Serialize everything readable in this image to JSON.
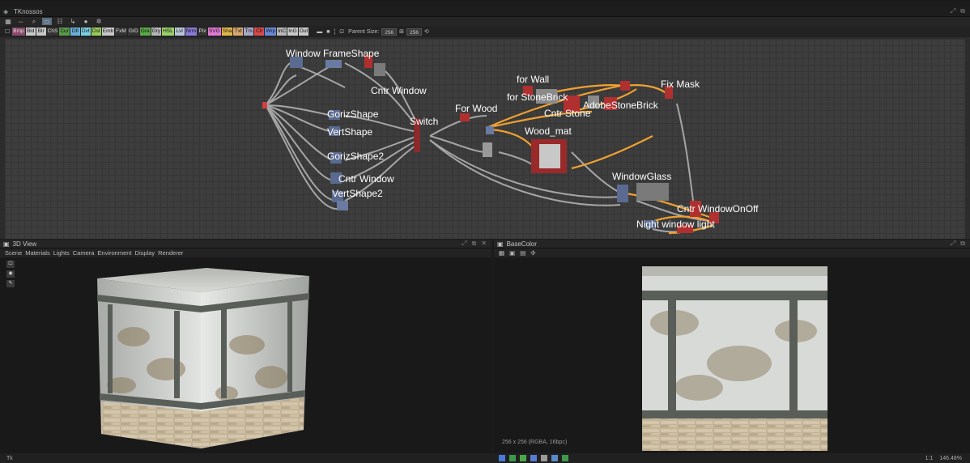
{
  "app": {
    "title": "TKnossos"
  },
  "graph_toolbar": {
    "items": [
      "grid-icon",
      "layout-icon",
      "zoom-icon",
      "select-icon",
      "align-icon",
      "connector-icon",
      "comment-icon",
      "settings-icon"
    ]
  },
  "filter_bar": {
    "chips": [
      {
        "label": "Bmp",
        "color": "#8a4a6a"
      },
      {
        "label": "Bld",
        "color": "#c8c8c8"
      },
      {
        "label": "Blr",
        "color": "#c8c8c8"
      },
      {
        "label": "ChS",
        "color": "#333333"
      },
      {
        "label": "Cur",
        "color": "#5a9a4a"
      },
      {
        "label": "Dfl",
        "color": "#6ab0d8"
      },
      {
        "label": "Dvt",
        "color": "#7ad0e0"
      },
      {
        "label": "Dst",
        "color": "#9acb5a"
      },
      {
        "label": "Emb",
        "color": "#c8c8c8"
      },
      {
        "label": "FxM",
        "color": "#333333"
      },
      {
        "label": "GrD",
        "color": "#333333"
      },
      {
        "label": "Gra",
        "color": "#5aa84a"
      },
      {
        "label": "Gry",
        "color": "#b8b8b8"
      },
      {
        "label": "HSL",
        "color": "#9ad06a"
      },
      {
        "label": "Lvl",
        "color": "#b8c8d8"
      },
      {
        "label": "Nrm",
        "color": "#8a7ad8"
      },
      {
        "label": "Pix",
        "color": "#333333"
      },
      {
        "label": "SVG",
        "color": "#e07ad0"
      },
      {
        "label": "Sha",
        "color": "#e0b84a"
      },
      {
        "label": "Txt",
        "color": "#d8a870"
      },
      {
        "label": "Trs",
        "color": "#a8a8c8"
      },
      {
        "label": "Clr",
        "color": "#d84a4a"
      },
      {
        "label": "Wrp",
        "color": "#6a8ad8"
      },
      {
        "label": "InC",
        "color": "#b8b8b8"
      },
      {
        "label": "InG",
        "color": "#c8c8c8"
      },
      {
        "label": "Out",
        "color": "#c8c8c8"
      }
    ],
    "parent_size_label": "Parent Size:",
    "size_x": "256",
    "size_y": "256"
  },
  "graph_nodes": [
    "Window FrameShape",
    "Cntr Window",
    "Switch",
    "For Wood",
    "for Wall",
    "for StoneBrick",
    "Cntr Stone",
    "AdobeStoneBrick",
    "Wood_mat",
    "Fix Mask",
    "GorizShape",
    "VertShape",
    "GorizShape2",
    "Cntr Window",
    "VertShape2",
    "WindowGlass",
    "Cntr WindowOnOff",
    "Night window light"
  ],
  "view3d": {
    "title": "3D View",
    "menu": [
      "Scene",
      "Materials",
      "Lights",
      "Camera",
      "Environment",
      "Display",
      "Renderer"
    ]
  },
  "view2d": {
    "title": "BaseColor",
    "resolution": "256 x 256 (RGBA, 16bpc)"
  },
  "statusbar": {
    "left": "Tk",
    "zoom_label": "1:1",
    "zoom_percent": "146.48%"
  }
}
